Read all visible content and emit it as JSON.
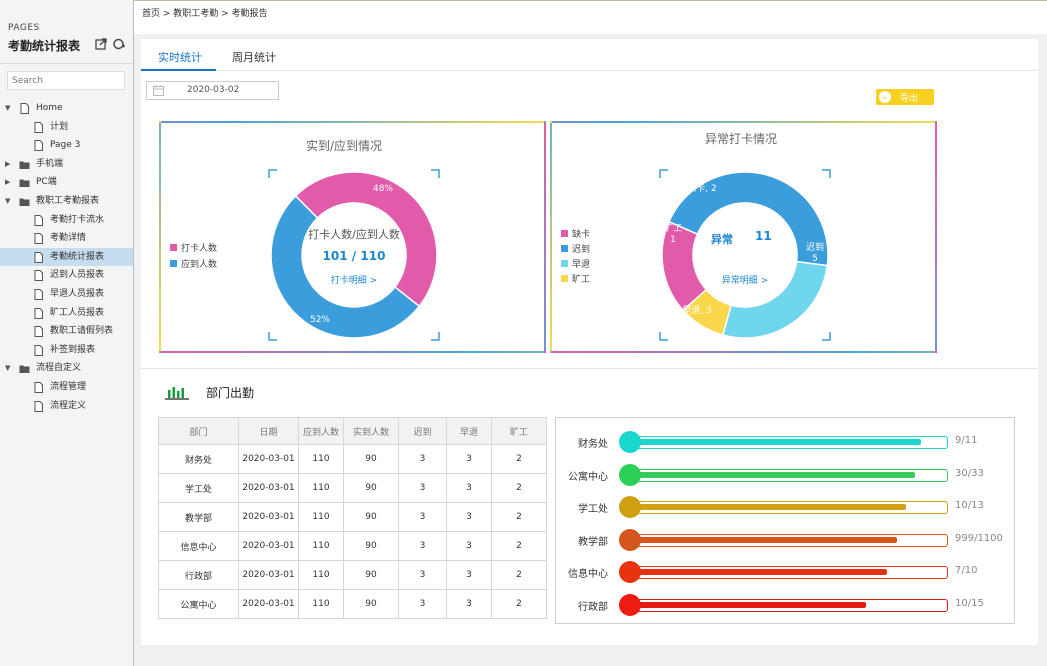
{
  "sidebar": {
    "pages_label": "PAGES",
    "title": "考勤统计报表",
    "search_placeholder": "Search",
    "items": [
      {
        "label": "Home",
        "type": "page",
        "caret": "▼",
        "depth": 0
      },
      {
        "label": "计划",
        "type": "page",
        "depth": 1
      },
      {
        "label": "Page 3",
        "type": "page",
        "depth": 1
      },
      {
        "label": "手机端",
        "type": "folder",
        "caret": "▶",
        "depth": 0
      },
      {
        "label": "PC端",
        "type": "folder",
        "caret": "▶",
        "depth": 0
      },
      {
        "label": "教职工考勤报表",
        "type": "folder",
        "caret": "▼",
        "depth": 0
      },
      {
        "label": "考勤打卡流水",
        "type": "page",
        "depth": 1
      },
      {
        "label": "考勤详情",
        "type": "page",
        "depth": 1
      },
      {
        "label": "考勤统计报表",
        "type": "page",
        "depth": 1,
        "active": true
      },
      {
        "label": "迟到人员报表",
        "type": "page",
        "depth": 1
      },
      {
        "label": "早退人员报表",
        "type": "page",
        "depth": 1
      },
      {
        "label": "旷工人员报表",
        "type": "page",
        "depth": 1
      },
      {
        "label": "教职工请假列表",
        "type": "page",
        "depth": 1
      },
      {
        "label": "补签到报表",
        "type": "page",
        "depth": 1
      },
      {
        "label": "流程自定义",
        "type": "folder",
        "caret": "▼",
        "depth": 0
      },
      {
        "label": "流程管理",
        "type": "page",
        "depth": 1
      },
      {
        "label": "流程定义",
        "type": "page",
        "depth": 1
      }
    ]
  },
  "breadcrumb": "首页 > 教职工考勤 > 考勤报告",
  "tabs": [
    {
      "label": "实时统计",
      "active": true
    },
    {
      "label": "周月统计",
      "active": false
    }
  ],
  "date_filter": "2020-03-02",
  "export_label": "导出",
  "attendance_card": {
    "title": "实到/应到情况",
    "center_title": "打卡人数/应到人数",
    "center_value": "101 / 110",
    "center_link": "打卡明细 >",
    "legend": [
      {
        "name": "打卡人数",
        "color": "#e25aaa"
      },
      {
        "name": "应到人数",
        "color": "#3b9ddb"
      }
    ]
  },
  "abnormal_card": {
    "title": "异常打卡情况",
    "center_label": "异常",
    "center_value": "11",
    "center_link": "异常明细 >",
    "legend": [
      {
        "name": "缺卡",
        "color": "#e25aaa"
      },
      {
        "name": "迟到",
        "color": "#3b9ddb"
      },
      {
        "name": "早退",
        "color": "#6fd6ee"
      },
      {
        "name": "旷工",
        "color": "#fad64b"
      }
    ]
  },
  "chart_data": [
    {
      "type": "pie",
      "title": "实到/应到情况",
      "labels": [
        "打卡人数",
        "应到人数"
      ],
      "values": [
        48,
        52
      ],
      "data_labels": [
        "48%",
        "52%"
      ],
      "colors": [
        "#e25aaa",
        "#3b9ddb"
      ]
    },
    {
      "type": "pie",
      "title": "异常打卡情况",
      "labels": [
        "缺卡",
        "迟到",
        "早退",
        "旷工"
      ],
      "values": [
        2,
        5,
        3,
        1
      ],
      "data_labels": [
        "缺卡, 2",
        "迟到\n5",
        "早退, 3",
        "旷工\n1"
      ],
      "colors": [
        "#e25aaa",
        "#3b9ddb",
        "#6fd6ee",
        "#fad64b"
      ]
    }
  ],
  "department": {
    "title": "部门出勤",
    "table": {
      "headers": [
        "部门",
        "日期",
        "应到人数",
        "实到人数",
        "迟到",
        "早退",
        "旷工"
      ],
      "rows": [
        [
          "财务处",
          "2020-03-01",
          "110",
          "90",
          "3",
          "3",
          "2"
        ],
        [
          "学工处",
          "2020-03-01",
          "110",
          "90",
          "3",
          "3",
          "2"
        ],
        [
          "教学部",
          "2020-03-01",
          "110",
          "90",
          "3",
          "3",
          "2"
        ],
        [
          "信息中心",
          "2020-03-01",
          "110",
          "90",
          "3",
          "3",
          "2"
        ],
        [
          "行政部",
          "2020-03-01",
          "110",
          "90",
          "3",
          "3",
          "2"
        ],
        [
          "公寓中心",
          "2020-03-01",
          "110",
          "90",
          "3",
          "3",
          "2"
        ]
      ]
    },
    "bars": [
      {
        "name": "财务处",
        "ratio": "9/11",
        "fill_pct": 93,
        "color": "#19d6cf",
        "dark": "#19d6cf"
      },
      {
        "name": "公寓中心",
        "ratio": "30/33",
        "fill_pct": 91,
        "color": "#37c85e",
        "dark": "#2bcf55"
      },
      {
        "name": "学工处",
        "ratio": "10/13",
        "fill_pct": 88,
        "color": "#d2a212",
        "dark": "#cfa012"
      },
      {
        "name": "教学部",
        "ratio": "999/1100",
        "fill_pct": 85,
        "color": "#d8551a",
        "dark": "#d4561e"
      },
      {
        "name": "信息中心",
        "ratio": "7/10",
        "fill_pct": 82,
        "color": "#e2320f",
        "dark": "#e8330f"
      },
      {
        "name": "行政部",
        "ratio": "10/15",
        "fill_pct": 75,
        "color": "#e31b12",
        "dark": "#ee1b10"
      }
    ]
  }
}
